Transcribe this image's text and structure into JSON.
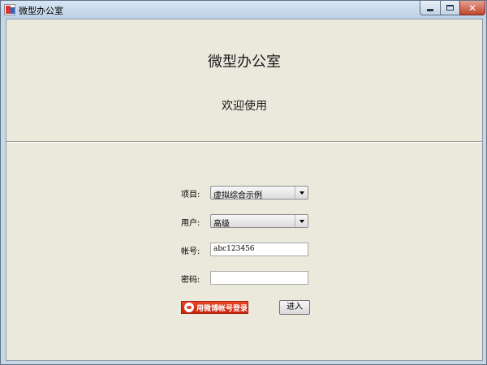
{
  "window": {
    "title": "微型办公室",
    "icon": "app-icon",
    "controls": {
      "minimize": "minimize-icon",
      "maximize": "maximize-icon",
      "close": "✕"
    }
  },
  "banner": {
    "app_title": "微型办公室",
    "welcome": "欢迎使用"
  },
  "form": {
    "project": {
      "label": "项目:",
      "value": "虚拟综合示例"
    },
    "user": {
      "label": "用户:",
      "value": "高级"
    },
    "account": {
      "label": "帐号:",
      "value": "abc123456"
    },
    "password": {
      "label": "密码:",
      "value": ""
    }
  },
  "buttons": {
    "weibo_login": "用微博帐号登录",
    "enter": "进入"
  },
  "colors": {
    "client_bg": "#ebe9dc",
    "weibo_red": "#d63415"
  }
}
